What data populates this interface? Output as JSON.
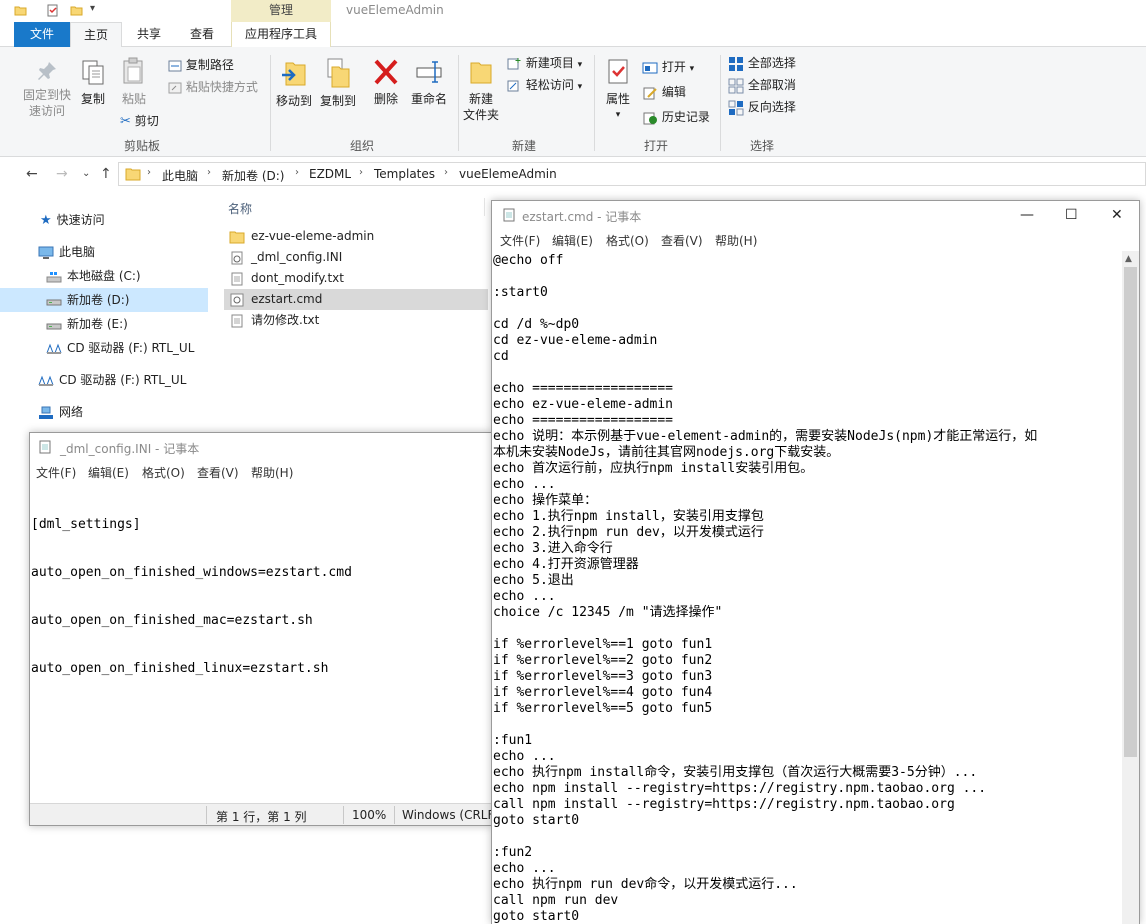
{
  "explorer": {
    "window_title": "vueElemeAdmin",
    "contextual_tab": "管理",
    "tabs": {
      "file": "文件",
      "home": "主页",
      "share": "共享",
      "view": "查看",
      "app_tools": "应用程序工具"
    },
    "ribbon": {
      "pin_label": "固定到快速访问",
      "pin_line1": "固定到快",
      "pin_line2": "速访问",
      "copy": "复制",
      "paste": "粘贴",
      "copy_path": "复制路径",
      "paste_shortcut": "粘贴快捷方式",
      "cut": "剪切",
      "group_clipboard": "剪贴板",
      "move_to": "移动到",
      "copy_to": "复制到",
      "delete": "删除",
      "rename": "重命名",
      "group_organize": "组织",
      "new_folder_line1": "新建",
      "new_folder_line2": "文件夹",
      "new_item": "新建项目",
      "easy_access": "轻松访问",
      "group_new": "新建",
      "properties": "属性",
      "open": "打开",
      "edit": "编辑",
      "history": "历史记录",
      "group_open": "打开",
      "select_all": "全部选择",
      "select_none": "全部取消",
      "invert_selection": "反向选择",
      "group_select": "选择"
    },
    "address": [
      "此电脑",
      "新加卷 (D:)",
      "EZDML",
      "Templates",
      "vueElemeAdmin"
    ],
    "nav": {
      "quick_access": "快速访问",
      "this_pc": "此电脑",
      "local_c": "本地磁盘 (C:)",
      "new_d": "新加卷 (D:)",
      "new_e": "新加卷 (E:)",
      "cd_f_nested": "CD 驱动器 (F:) RTL_UL",
      "cd_f": "CD 驱动器 (F:) RTL_UL",
      "network": "网络"
    },
    "list": {
      "column_name": "名称",
      "files": [
        "ez-vue-eleme-admin",
        "_dml_config.INI",
        "dont_modify.txt",
        "ezstart.cmd",
        "请勿修改.txt"
      ]
    }
  },
  "notepad_ini": {
    "title": "_dml_config.INI - 记事本",
    "menu": [
      "文件(F)",
      "编辑(E)",
      "格式(O)",
      "查看(V)",
      "帮助(H)"
    ],
    "lines": [
      "[dml_settings]",
      "auto_open_on_finished_windows=ezstart.cmd",
      "auto_open_on_finished_mac=ezstart.sh",
      "auto_open_on_finished_linux=ezstart.sh"
    ],
    "status": {
      "position": "第 1 行，第 1 列",
      "zoom": "100%",
      "encoding": "Windows (CRLF"
    }
  },
  "notepad_cmd": {
    "title": "ezstart.cmd - 记事本",
    "menu": [
      "文件(F)",
      "编辑(E)",
      "格式(O)",
      "查看(V)",
      "帮助(H)"
    ],
    "lines": [
      "@echo off",
      "",
      ":start0",
      "",
      "cd /d %~dp0",
      "cd ez-vue-eleme-admin",
      "cd",
      "",
      "echo ==================",
      "echo ez-vue-eleme-admin",
      "echo ==================",
      "echo 说明：本示例基于vue-element-admin的，需要安装NodeJs(npm)才能正常运行，如",
      "本机未安装NodeJs，请前往其官网nodejs.org下载安装。",
      "echo 首次运行前，应执行npm install安装引用包。",
      "echo ...",
      "echo 操作菜单：",
      "echo 1.执行npm install，安装引用支撑包",
      "echo 2.执行npm run dev，以开发模式运行",
      "echo 3.进入命令行",
      "echo 4.打开资源管理器",
      "echo 5.退出",
      "echo ...",
      "choice /c 12345 /m \"请选择操作\"",
      "",
      "if %errorlevel%==1 goto fun1",
      "if %errorlevel%==2 goto fun2",
      "if %errorlevel%==3 goto fun3",
      "if %errorlevel%==4 goto fun4",
      "if %errorlevel%==5 goto fun5",
      "",
      ":fun1",
      "echo ...",
      "echo 执行npm install命令，安装引用支撑包（首次运行大概需要3-5分钟）...",
      "echo npm install --registry=https://registry.npm.taobao.org ...",
      "call npm install --registry=https://registry.npm.taobao.org",
      "goto start0",
      "",
      ":fun2",
      "echo ...",
      "echo 执行npm run dev命令，以开发模式运行...",
      "call npm run dev",
      "goto start0"
    ]
  }
}
